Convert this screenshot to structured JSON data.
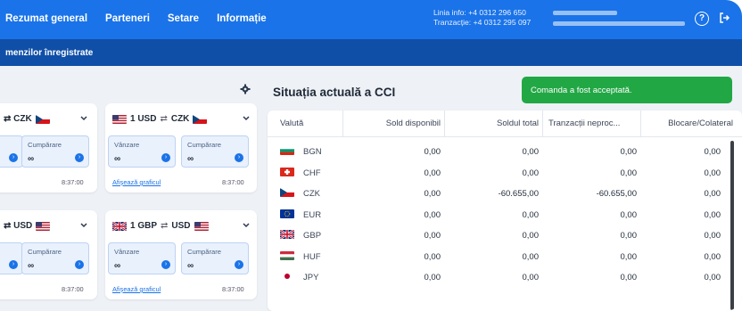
{
  "topbar": {
    "nav": [
      "Rezumat general",
      "Parteneri",
      "Setare",
      "Informație"
    ],
    "contact_line1": "Linia info: +4 0312 296 650",
    "contact_line2": "Tranzacție: +4 0312 295 097"
  },
  "subbar": {
    "text": "menzilor înregistrate"
  },
  "cards": [
    {
      "head_left": "⇄ CZK",
      "head_right_flag": "cz",
      "buy_label": "Cumpărare",
      "buy_value": "∞",
      "time": "8:37:00"
    },
    {
      "head_from_amount": "1 USD",
      "head_from_flag": "us",
      "head_to": "CZK",
      "head_to_flag": "cz",
      "sell_label": "Vânzare",
      "sell_value": "∞",
      "buy_label": "Cumpărare",
      "buy_value": "∞",
      "link": "Afișează graficul",
      "time": "8:37:00"
    },
    {
      "head_left": "⇄ USD",
      "head_right_flag": "us",
      "buy_label": "Cumpărare",
      "buy_value": "∞",
      "time": "8:37:00"
    },
    {
      "head_from_amount": "1 GBP",
      "head_from_flag": "gb",
      "head_to": "USD",
      "head_to_flag": "us",
      "sell_label": "Vânzare",
      "sell_value": "∞",
      "buy_label": "Cumpărare",
      "buy_value": "∞",
      "link": "Afișează graficul",
      "time": "8:37:00"
    }
  ],
  "main": {
    "title": "Situația actuală a CCI",
    "toast": "Comanda a fost acceptată.",
    "columns": [
      "Valută",
      "Sold disponibil",
      "Soldul total",
      "Tranzacții neproc...",
      "Blocare/Colateral"
    ],
    "rows": [
      {
        "currency": "BGN",
        "flag": "bg",
        "available": "0,00",
        "total": "0,00",
        "pending": "0,00",
        "blocked": "0,00"
      },
      {
        "currency": "CHF",
        "flag": "ch",
        "available": "0,00",
        "total": "0,00",
        "pending": "0,00",
        "blocked": "0,00"
      },
      {
        "currency": "CZK",
        "flag": "cz",
        "available": "0,00",
        "total": "-60.655,00",
        "pending": "-60.655,00",
        "blocked": "0,00"
      },
      {
        "currency": "EUR",
        "flag": "eu",
        "available": "0,00",
        "total": "0,00",
        "pending": "0,00",
        "blocked": "0,00"
      },
      {
        "currency": "GBP",
        "flag": "gb",
        "available": "0,00",
        "total": "0,00",
        "pending": "0,00",
        "blocked": "0,00"
      },
      {
        "currency": "HUF",
        "flag": "hu",
        "available": "0,00",
        "total": "0,00",
        "pending": "0,00",
        "blocked": "0,00"
      },
      {
        "currency": "JPY",
        "flag": "jp",
        "available": "0,00",
        "total": "0,00",
        "pending": "0,00",
        "blocked": "0,00"
      }
    ]
  },
  "colors": {
    "primary": "#1a73e8",
    "subbar": "#0f4fa8",
    "success": "#22a745"
  }
}
